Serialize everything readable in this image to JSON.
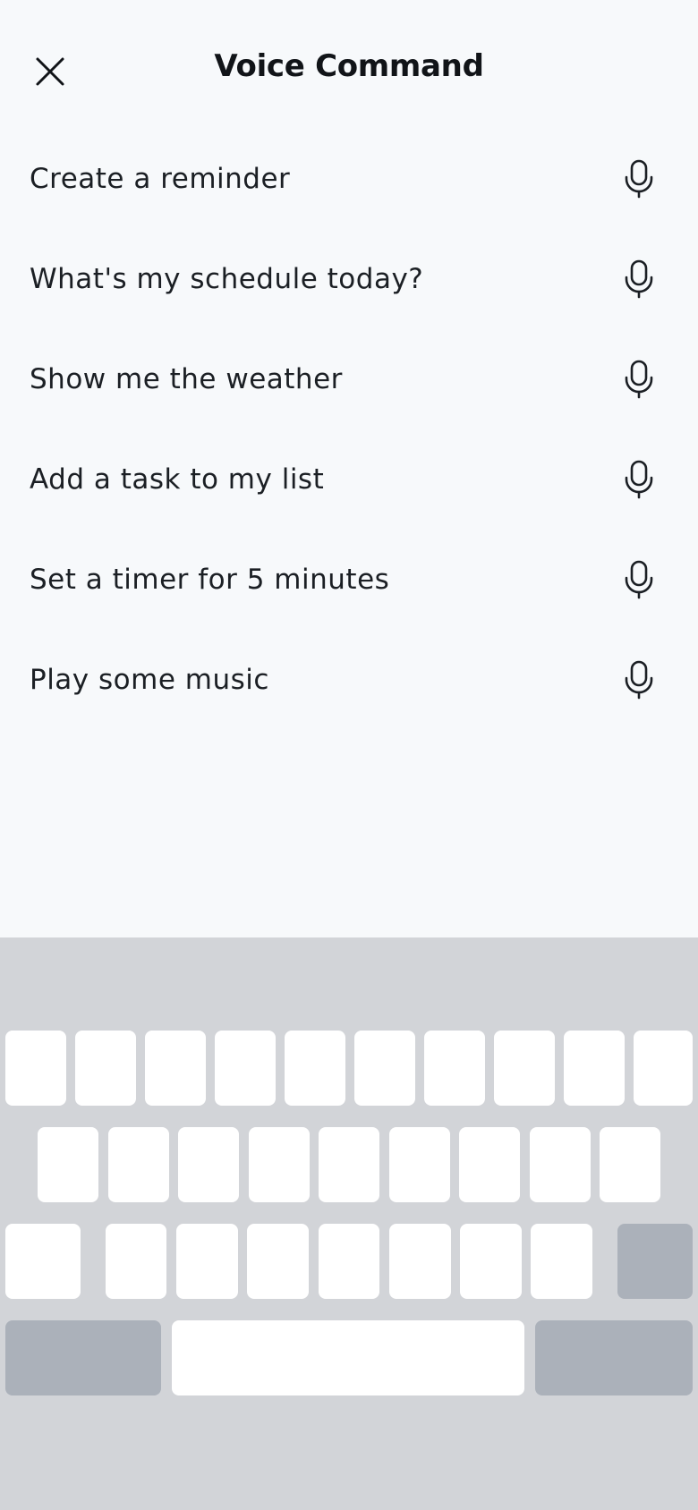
{
  "header": {
    "title": "Voice Command",
    "close_icon": "close-icon"
  },
  "commands": [
    {
      "label": "Create a reminder",
      "icon": "microphone-icon"
    },
    {
      "label": "What's my schedule today?",
      "icon": "microphone-icon"
    },
    {
      "label": "Show me the weather",
      "icon": "microphone-icon"
    },
    {
      "label": "Add a task to my list",
      "icon": "microphone-icon"
    },
    {
      "label": "Set a timer for 5 minutes",
      "icon": "microphone-icon"
    },
    {
      "label": "Play some music",
      "icon": "microphone-icon"
    }
  ],
  "colors": {
    "background": "#f7f9fb",
    "keyboard_background": "#d2d4d8",
    "key": "#ffffff",
    "function_key": "#abb1ba",
    "text": "#1b1f24"
  }
}
